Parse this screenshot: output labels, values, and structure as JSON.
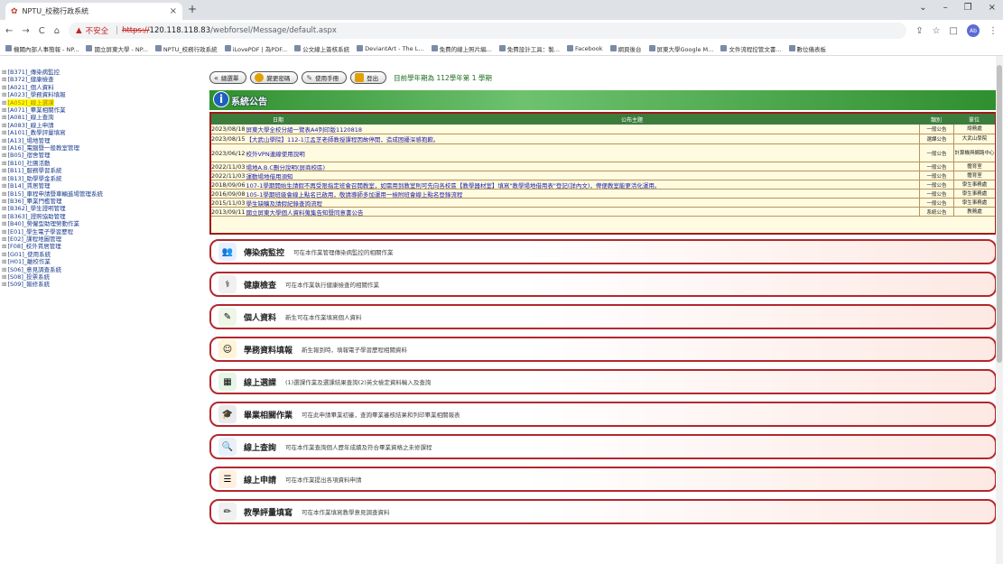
{
  "browser": {
    "tab_title": "NPTU_校務行政系統",
    "warning_label": "不安全",
    "url_scheme": "https://",
    "url_host": "120.118.118.83",
    "url_path": "/webforsel/Message/default.aspx",
    "profile_initials": "Ab",
    "bookmarks": [
      "機關內部人事簡報 - NP...",
      "國立屏東大學 - NP...",
      "NPTU_校務行政系統",
      "iLovePDF | 為PDF...",
      "公文線上簽核系統",
      "DeviantArt - The L...",
      "免費的線上照片編...",
      "免費設計工具：製...",
      "Facebook",
      "網頁後台",
      "屏東大學Google M...",
      "文件流程控管文書...",
      "數位儀表板"
    ]
  },
  "sidebar": {
    "items": [
      {
        "label": "[B371]_傳染病監控"
      },
      {
        "label": "[B372]_健康檢查"
      },
      {
        "label": "[A021]_個人資料"
      },
      {
        "label": "[A023]_學務資料填報"
      },
      {
        "label": "[A052]_線上選課",
        "selected": true
      },
      {
        "label": "[A071]_畢業相關作業"
      },
      {
        "label": "[A081]_線上查詢"
      },
      {
        "label": "[A083]_線上申請"
      },
      {
        "label": "[A101]_教學評量填寫"
      },
      {
        "label": "[A13]_場地管理"
      },
      {
        "label": "[A16]_電腦暨一般教室管理"
      },
      {
        "label": "[B05]_宿舍管理"
      },
      {
        "label": "[B10]_社團活動"
      },
      {
        "label": "[B11]_服務學習系統"
      },
      {
        "label": "[B13]_助學學金系統"
      },
      {
        "label": "[B14]_賃居管理"
      },
      {
        "label": "[B15]_車程申請暨車輛進場管理系統"
      },
      {
        "label": "[B36]_畢業門檻管理"
      },
      {
        "label": "[B362]_學生證明管理"
      },
      {
        "label": "[B363]_證照協助管理"
      },
      {
        "label": "[B40]_勞僱型助理勞動作業"
      },
      {
        "label": "[E01]_學生電子學習歷程"
      },
      {
        "label": "[E02]_課程地圖管理"
      },
      {
        "label": "[F08]_校外賃居管理"
      },
      {
        "label": "[G01]_使用系統"
      },
      {
        "label": "[H01]_離校作業"
      },
      {
        "label": "[S06]_意見調查系統"
      },
      {
        "label": "[S08]_投票系統"
      },
      {
        "label": "[S09]_報修系統"
      }
    ]
  },
  "toolbar": {
    "buttons": [
      "總選單",
      "變更密碼",
      "使用手冊",
      "登出"
    ],
    "term_text": "目前學年期為 112學年第 1 學期"
  },
  "notice": {
    "banner_title": "系統公告",
    "headers": {
      "date": "日期",
      "title": "公布主題",
      "type": "類別",
      "unit": "單位"
    },
    "rows": [
      {
        "date": "2023/08/18",
        "title": "屏東大學全校分組一覽表A4列印版1120818",
        "type": "一般公告",
        "unit": "總務處"
      },
      {
        "date": "2023/08/15",
        "title": "【大武山學院】112-1江孟芝老師教授課程因故停開，造成困擾深感抱歉。",
        "type": "選課公告",
        "unit": "大武山學院"
      },
      {
        "date": "2023/06/12",
        "title": "校外VPN連線使用說明",
        "type": "一般公告",
        "unit": "計算機與網路中心"
      },
      {
        "date": "2022/11/03",
        "title": "場地A.B.C劃分說明(屏商校區)",
        "type": "一般公告",
        "unit": "體育室"
      },
      {
        "date": "2022/11/03",
        "title": "運動場地借用須知",
        "type": "一般公告",
        "unit": "體育室"
      },
      {
        "date": "2018/09/06",
        "title": "107-1學期開始生請假不再受限指定班會召開教室，如需用到教室則可先向各校區【教學器材室】填寫\"教學場地借用表\"登記(詳內文)，俾便教室能更活化運用。",
        "type": "一般公告",
        "unit": "學生事務處"
      },
      {
        "date": "2016/09/08",
        "title": "105-1學期班級會線上點名已啟用，敬請導師多加運用一檢附班會線上點名登錄流程",
        "type": "一般公告",
        "unit": "學生事務處"
      },
      {
        "date": "2015/11/03",
        "title": "學生缺曠及請假紀錄查詢流程",
        "type": "一般公告",
        "unit": "學生事務處"
      },
      {
        "date": "2013/09/11",
        "title": "國立屏東大學個人資料蒐集告知暨同意書公告",
        "type": "系統公告",
        "unit": "教務處"
      }
    ]
  },
  "modules": [
    {
      "title": "傳染病監控",
      "desc": "可在本作業管理傳染病監控的相關作業",
      "icon": "people-icon",
      "color": "#e8f0ff"
    },
    {
      "title": "健康檢查",
      "desc": "可在本作業執行健康檢查的相關作業",
      "icon": "health-icon",
      "color": "#f0f0f0"
    },
    {
      "title": "個人資料",
      "desc": "新生可在本作業填寫個人資料",
      "icon": "notebook-icon",
      "color": "#eef6e8"
    },
    {
      "title": "學務資料填報",
      "desc": "新生報到時，填報電子學習歷程相關資料",
      "icon": "person-icon",
      "color": "#fff4d6"
    },
    {
      "title": "線上選課",
      "desc": "(1)選課作業及選課結果查詢(2)英文檢定資料輸入及查詢",
      "icon": "chalkboard-icon",
      "color": "#e6f6e6"
    },
    {
      "title": "畢業相關作業",
      "desc": "可在此申請畢業初審，查詢畢業審核結果和列印畢業相關報表",
      "icon": "graduation-cap-icon",
      "color": "#eaeaea"
    },
    {
      "title": "線上查詢",
      "desc": "可在本作業查詢個人歷年成績及符合畢業資格之未修課程",
      "icon": "search-doc-icon",
      "color": "#e8f1fb"
    },
    {
      "title": "線上申請",
      "desc": "可在本作業提出各項資料申請",
      "icon": "form-icon",
      "color": "#fff0e0"
    },
    {
      "title": "教學評量填寫",
      "desc": "可在本作業填寫教學意見調查資料",
      "icon": "pencil-icon",
      "color": "#f0f0f0"
    }
  ]
}
